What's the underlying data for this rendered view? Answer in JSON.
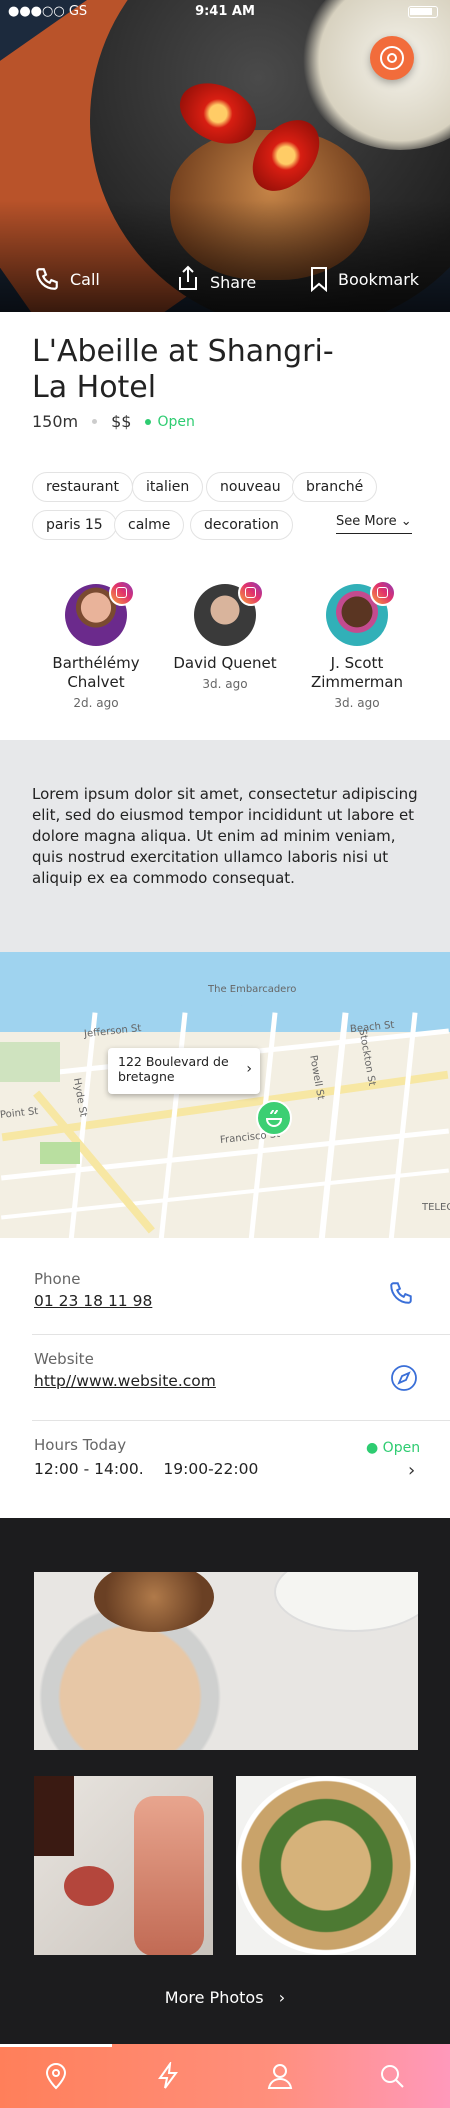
{
  "status_bar": {
    "carrier": "●●●○○ GS",
    "time": "9:41 AM"
  },
  "hero": {
    "call": "Call",
    "share": "Share",
    "bookmark": "Bookmark"
  },
  "place": {
    "name": "L'Abeille at Shangri-La Hotel",
    "distance": "150m",
    "price": "$$",
    "status": "Open"
  },
  "tags": [
    "restaurant",
    "italien",
    "nouveau",
    "branché",
    "paris 15",
    "calme",
    "decoration"
  ],
  "see_more": "See More",
  "reviewers": [
    {
      "name": "Barthélémy Chalvet",
      "ago": "2d. ago"
    },
    {
      "name": "David Quenet",
      "ago": "3d. ago"
    },
    {
      "name": "J. Scott Zimmerman",
      "ago": "3d. ago"
    }
  ],
  "description": "Lorem ipsum dolor sit amet, consectetur adipiscing elit, sed do eiusmod tempor incididunt ut labore et dolore magna aliqua. Ut enim ad minim veniam, quis nostrud exercitation ullamco laboris nisi ut aliquip ex ea commodo consequat.",
  "map": {
    "address": "122 Boulevard de bretagne",
    "streets": {
      "embarcadero": "The Embarcadero",
      "jefferson": "Jefferson St",
      "beach": "Beach St",
      "hyde": "Hyde St",
      "powell": "Powell St",
      "stockton": "Stockton St",
      "francisco": "Francisco St",
      "point": "Point St",
      "telegraph": "TELEGRA HILL"
    }
  },
  "contact": {
    "phone_label": "Phone",
    "phone": "01 23 18 11 98",
    "website_label": "Website",
    "website": "http//www.website.com",
    "hours_label": "Hours Today",
    "hours": "12:00 - 14:00.    19:00-22:00",
    "hours_status": "Open"
  },
  "gallery": {
    "more_photos": "More Photos"
  },
  "colors": {
    "accent": "#f26c3b",
    "open": "#2ecc71",
    "link": "#3a6fd8"
  }
}
